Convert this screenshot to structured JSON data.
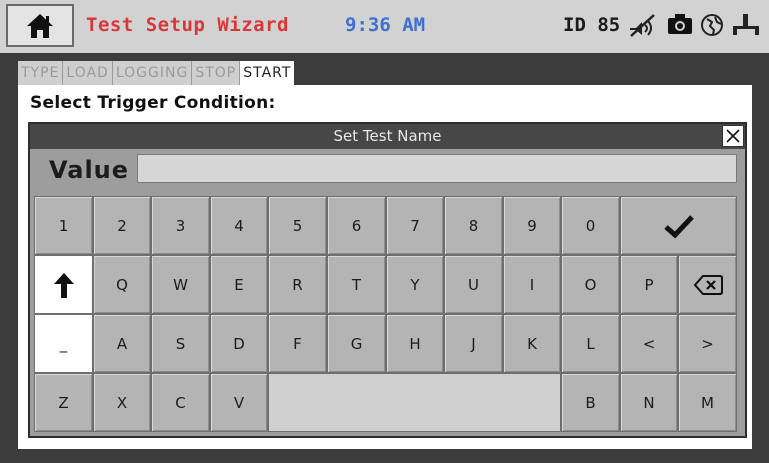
{
  "header": {
    "title": "Test Setup Wizard",
    "time": "9:36 AM",
    "id_label": "ID 85",
    "icons": [
      "home-icon",
      "mute-icon",
      "camera-icon",
      "network-icon",
      "usb-icon"
    ]
  },
  "tabs": [
    {
      "label": "TYPE",
      "active": false
    },
    {
      "label": "LOAD",
      "active": false
    },
    {
      "label": "LOGGING",
      "active": false
    },
    {
      "label": "STOP",
      "active": false
    },
    {
      "label": "START",
      "active": true
    }
  ],
  "panel": {
    "prompt": "Select Trigger Condition:"
  },
  "dialog": {
    "title": "Set Test Name",
    "value_label": "Value",
    "value": "",
    "rows": [
      [
        "1",
        "2",
        "3",
        "4",
        "5",
        "6",
        "7",
        "8",
        "9",
        "0"
      ],
      [
        "Q",
        "W",
        "E",
        "R",
        "T",
        "Y",
        "U",
        "I",
        "O",
        "P"
      ],
      [
        "_",
        "A",
        "S",
        "D",
        "F",
        "G",
        "H",
        "J",
        "K",
        "L",
        "<",
        ">"
      ],
      [
        "Z",
        "X",
        "C",
        "V",
        "B",
        "N",
        "M"
      ]
    ],
    "special_keys": {
      "enter": "checkmark-icon",
      "shift": "shift-arrow-icon",
      "backspace": "backspace-icon"
    }
  },
  "colors": {
    "title": "#d9383a",
    "time": "#3f6fd1",
    "header_bg": "#d2d2d2",
    "dialog_bg": "#9d9d9d"
  }
}
